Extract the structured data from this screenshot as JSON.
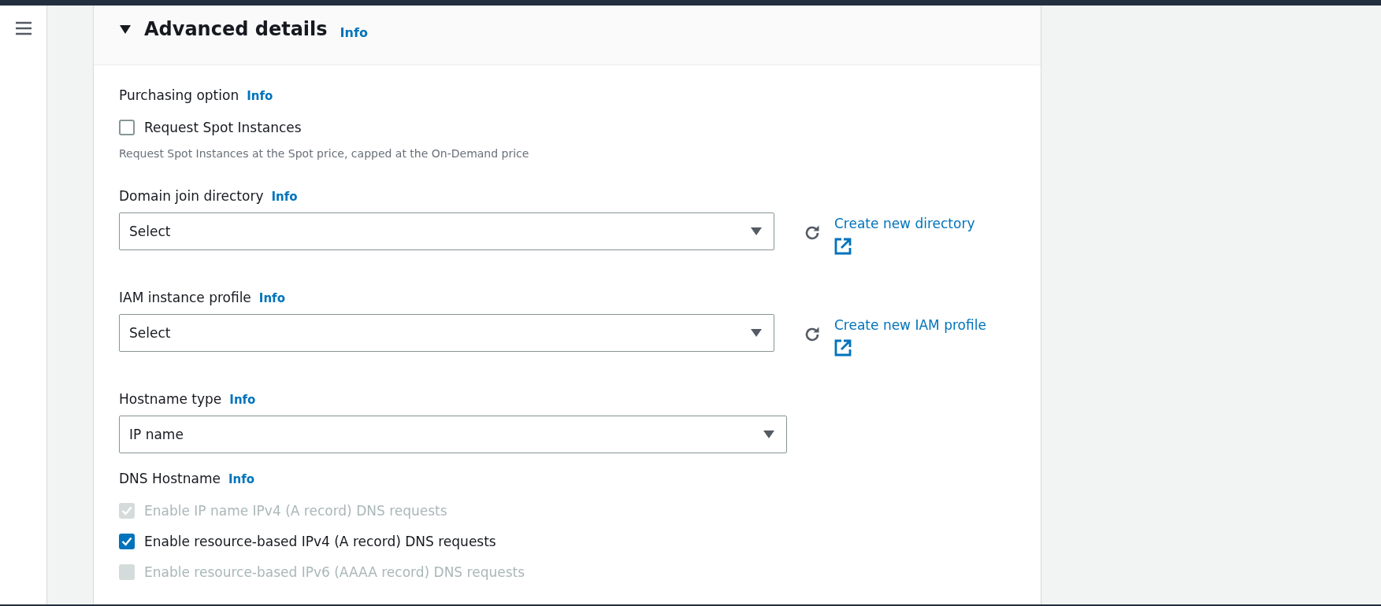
{
  "section": {
    "title": "Advanced details",
    "info": "Info",
    "expanded": true
  },
  "fields": [
    {
      "kind": "checkboxes",
      "label": "Purchasing option",
      "info": "Info",
      "options": [
        {
          "label": "Request Spot Instances",
          "checked": false,
          "disabled": false
        }
      ],
      "description": "Request Spot Instances at the Spot price, capped at the On-Demand price"
    },
    {
      "kind": "select",
      "label": "Domain join directory",
      "info": "Info",
      "value": "Select",
      "link": "Create new directory"
    },
    {
      "kind": "select",
      "label": "IAM instance profile",
      "info": "Info",
      "value": "Select",
      "link": "Create new IAM profile"
    },
    {
      "kind": "select",
      "label": "Hostname type",
      "info": "Info",
      "value": "IP name"
    },
    {
      "kind": "checkboxes",
      "label": "DNS Hostname",
      "info": "Info",
      "options": [
        {
          "label": "Enable IP name IPv4 (A record) DNS requests",
          "checked": true,
          "disabled": true
        },
        {
          "label": "Enable resource-based IPv4 (A record) DNS requests",
          "checked": true,
          "disabled": false
        },
        {
          "label": "Enable resource-based IPv6 (AAAA record) DNS requests",
          "checked": false,
          "disabled": true
        }
      ]
    }
  ]
}
